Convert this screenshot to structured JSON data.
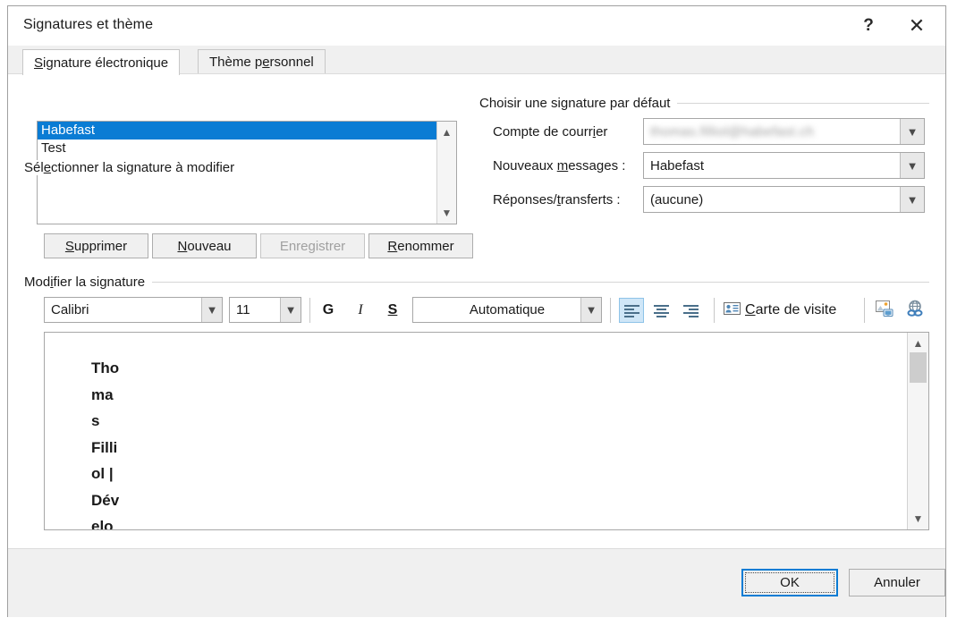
{
  "window": {
    "title": "Signatures et thème",
    "help_icon": "question-mark-icon",
    "close_icon": "close-icon"
  },
  "tabs": [
    {
      "label": "Signature électronique",
      "accel": "S",
      "active": true
    },
    {
      "label": "Thème personnel",
      "accel": "e",
      "active": false
    }
  ],
  "select_signature": {
    "group_label": "Sélectionner la signature à modifier",
    "items": [
      {
        "label": "Habefast",
        "selected": true
      },
      {
        "label": "Test",
        "selected": false
      }
    ],
    "buttons": [
      {
        "label": "Supprimer",
        "accel": "S",
        "enabled": true
      },
      {
        "label": "Nouveau",
        "accel": "N",
        "enabled": true
      },
      {
        "label": "Enregistrer",
        "accel": "",
        "enabled": false
      },
      {
        "label": "Renommer",
        "accel": "R",
        "enabled": true
      }
    ]
  },
  "default_signature": {
    "group_label": "Choisir une signature par défaut",
    "rows": [
      {
        "label": "Compte de courrier",
        "accel": "i",
        "value": "thomas.filliol@habefast.ch",
        "redacted": true
      },
      {
        "label": "Nouveaux messages :",
        "accel": "m",
        "value": "Habefast",
        "redacted": false
      },
      {
        "label": "Réponses/transferts :",
        "accel": "t",
        "value": "(aucune)",
        "redacted": false
      }
    ]
  },
  "edit_signature": {
    "group_label": "Modifier la signature",
    "font_family": "Calibri",
    "font_size": "11",
    "bold_label": "G",
    "italic_label": "I",
    "underline_label": "S",
    "color": "Automatique",
    "align_left_icon": "align-left-icon",
    "align_center_icon": "align-center-icon",
    "align_right_icon": "align-right-icon",
    "business_card_label": "Carte de visite",
    "business_card_accel": "C",
    "business_card_icon": "business-card-icon",
    "picture_icon": "insert-picture-icon",
    "hyperlink_icon": "insert-hyperlink-icon",
    "content": "Tho\nma\ns\nFilli\nol |\nDév\nelo\nppe"
  },
  "footer": {
    "ok_label": "OK",
    "cancel_label": "Annuler"
  },
  "colors": {
    "accent": "#0a7cd4",
    "selection": "#0a7cd4",
    "toolbar_active": "#cfe6f7",
    "dialog_bg": "#f0f0f0",
    "content_bg": "#ffffff"
  }
}
